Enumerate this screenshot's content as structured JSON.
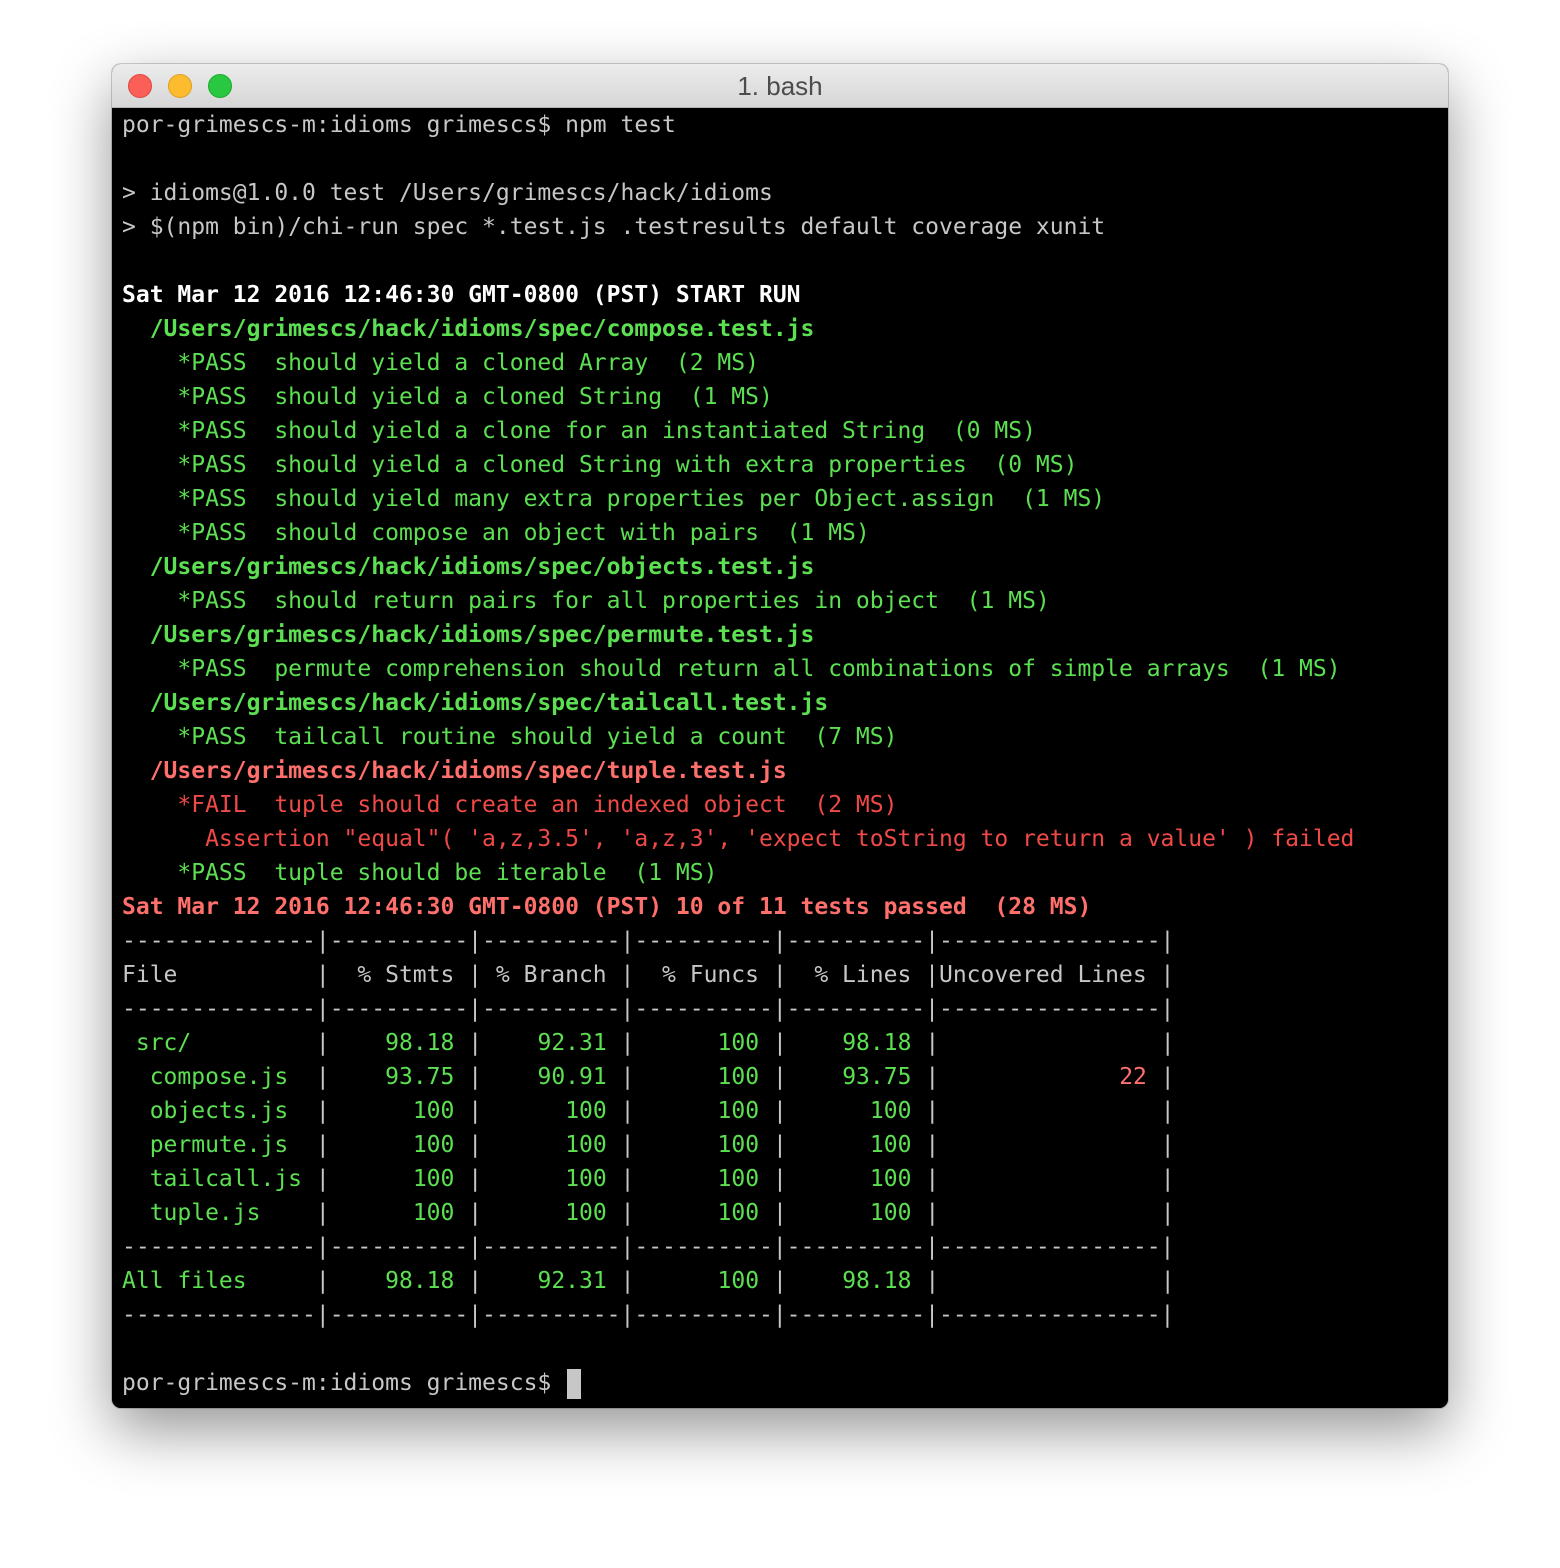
{
  "window": {
    "title": "1. bash"
  },
  "terminal": {
    "prompt": "por-grimescs-m:idioms grimescs$",
    "command": " npm test",
    "info_lines": [
      "> idioms@1.0.0 test /Users/grimescs/hack/idioms",
      "> $(npm bin)/chi-run spec *.test.js .testresults default coverage xunit"
    ],
    "start_run": "Sat Mar 12 2016 12:46:30 GMT-0800 (PST) START RUN",
    "suites": [
      {
        "path": "  /Users/grimescs/hack/idioms/spec/compose.test.js",
        "status": "pass",
        "tests": [
          {
            "status": "pass",
            "text": "    *PASS  should yield a cloned Array  (2 MS)"
          },
          {
            "status": "pass",
            "text": "    *PASS  should yield a cloned String  (1 MS)"
          },
          {
            "status": "pass",
            "text": "    *PASS  should yield a clone for an instantiated String  (0 MS)"
          },
          {
            "status": "pass",
            "text": "    *PASS  should yield a cloned String with extra properties  (0 MS)"
          },
          {
            "status": "pass",
            "text": "    *PASS  should yield many extra properties per Object.assign  (1 MS)"
          },
          {
            "status": "pass",
            "text": "    *PASS  should compose an object with pairs  (1 MS)"
          }
        ]
      },
      {
        "path": "  /Users/grimescs/hack/idioms/spec/objects.test.js",
        "status": "pass",
        "tests": [
          {
            "status": "pass",
            "text": "    *PASS  should return pairs for all properties in object  (1 MS)"
          }
        ]
      },
      {
        "path": "  /Users/grimescs/hack/idioms/spec/permute.test.js",
        "status": "pass",
        "tests": [
          {
            "status": "pass",
            "text": "    *PASS  permute comprehension should return all combinations of simple arrays  (1 MS)"
          }
        ]
      },
      {
        "path": "  /Users/grimescs/hack/idioms/spec/tailcall.test.js",
        "status": "pass",
        "tests": [
          {
            "status": "pass",
            "text": "    *PASS  tailcall routine should yield a count  (7 MS)"
          }
        ]
      },
      {
        "path": "  /Users/grimescs/hack/idioms/spec/tuple.test.js",
        "status": "fail",
        "tests": [
          {
            "status": "fail",
            "text": "    *FAIL  tuple should create an indexed object  (2 MS)"
          },
          {
            "status": "assert",
            "text": "      Assertion \"equal\"( 'a,z,3.5', 'a,z,3', 'expect toString to return a value' ) failed"
          },
          {
            "status": "pass",
            "text": "    *PASS  tuple should be iterable  (1 MS)"
          }
        ]
      }
    ],
    "summary": "Sat Mar 12 2016 12:46:30 GMT-0800 (PST) 10 of 11 tests passed  (28 MS)",
    "coverage": {
      "separator": "--------------|----------|----------|----------|----------|----------------|",
      "header": "File          |  % Stmts | % Branch |  % Funcs |  % Lines |Uncovered Lines |",
      "rows": [
        {
          "file": " src/         ",
          "stmts": "98.18",
          "branch": "92.31",
          "funcs": "100",
          "lines": "98.18",
          "uncovered": ""
        },
        {
          "file": "  compose.js  ",
          "stmts": "93.75",
          "branch": "90.91",
          "funcs": "100",
          "lines": "93.75",
          "uncovered": "22"
        },
        {
          "file": "  objects.js  ",
          "stmts": "100",
          "branch": "100",
          "funcs": "100",
          "lines": "100",
          "uncovered": ""
        },
        {
          "file": "  permute.js  ",
          "stmts": "100",
          "branch": "100",
          "funcs": "100",
          "lines": "100",
          "uncovered": ""
        },
        {
          "file": "  tailcall.js ",
          "stmts": "100",
          "branch": "100",
          "funcs": "100",
          "lines": "100",
          "uncovered": ""
        },
        {
          "file": "  tuple.js    ",
          "stmts": "100",
          "branch": "100",
          "funcs": "100",
          "lines": "100",
          "uncovered": ""
        }
      ],
      "total": {
        "file": "All files     ",
        "stmts": "98.18",
        "branch": "92.31",
        "funcs": "100",
        "lines": "98.18",
        "uncovered": ""
      }
    },
    "final_prompt": "por-grimescs-m:idioms grimescs$ "
  },
  "colors": {
    "background": "#000000",
    "default_text": "#c7c7c7",
    "pass": "#5ce052",
    "fail": "#ef4a48",
    "fail_header": "#ff6f6c"
  }
}
